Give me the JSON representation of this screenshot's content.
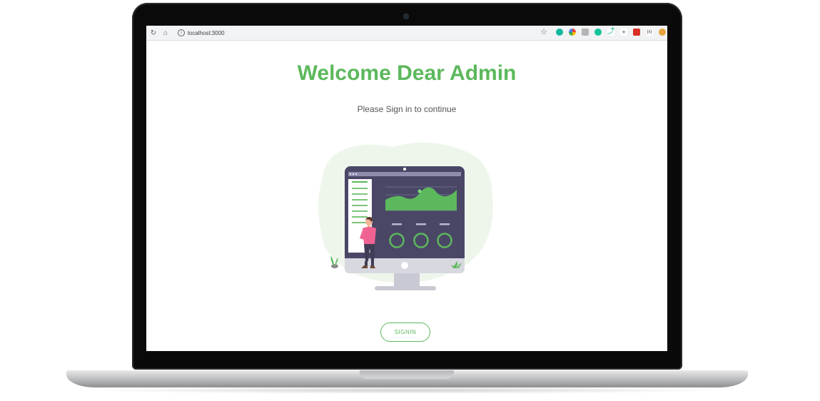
{
  "browser": {
    "url": "localhost:3000",
    "icons": [
      "reload-icon",
      "home-icon",
      "info-icon",
      "star-icon"
    ],
    "extensions": [
      {
        "name": "extension-teal-icon",
        "color": "#14b89f"
      },
      {
        "name": "extension-google-icon",
        "color": "#4285f4"
      },
      {
        "name": "extension-gray-icon",
        "color": "#8a8a8a"
      },
      {
        "name": "extension-grammarly-icon",
        "color": "#15c39a"
      },
      {
        "name": "extension-runner-icon",
        "color": "#00b386"
      },
      {
        "name": "extension-sparkle-icon",
        "color": "#b0b0b0"
      },
      {
        "name": "extension-red-icon",
        "color": "#d93025"
      },
      {
        "name": "extension-code-icon",
        "color": "#333333"
      },
      {
        "name": "extension-cookie-icon",
        "color": "#e8a33d"
      }
    ]
  },
  "page": {
    "title": "Welcome Dear Admin",
    "subtitle": "Please Sign in to continue",
    "signin_label": "SIGNIN"
  },
  "colors": {
    "accent": "#5cb85c",
    "monitor": "#4a4766",
    "text": "#555555"
  }
}
